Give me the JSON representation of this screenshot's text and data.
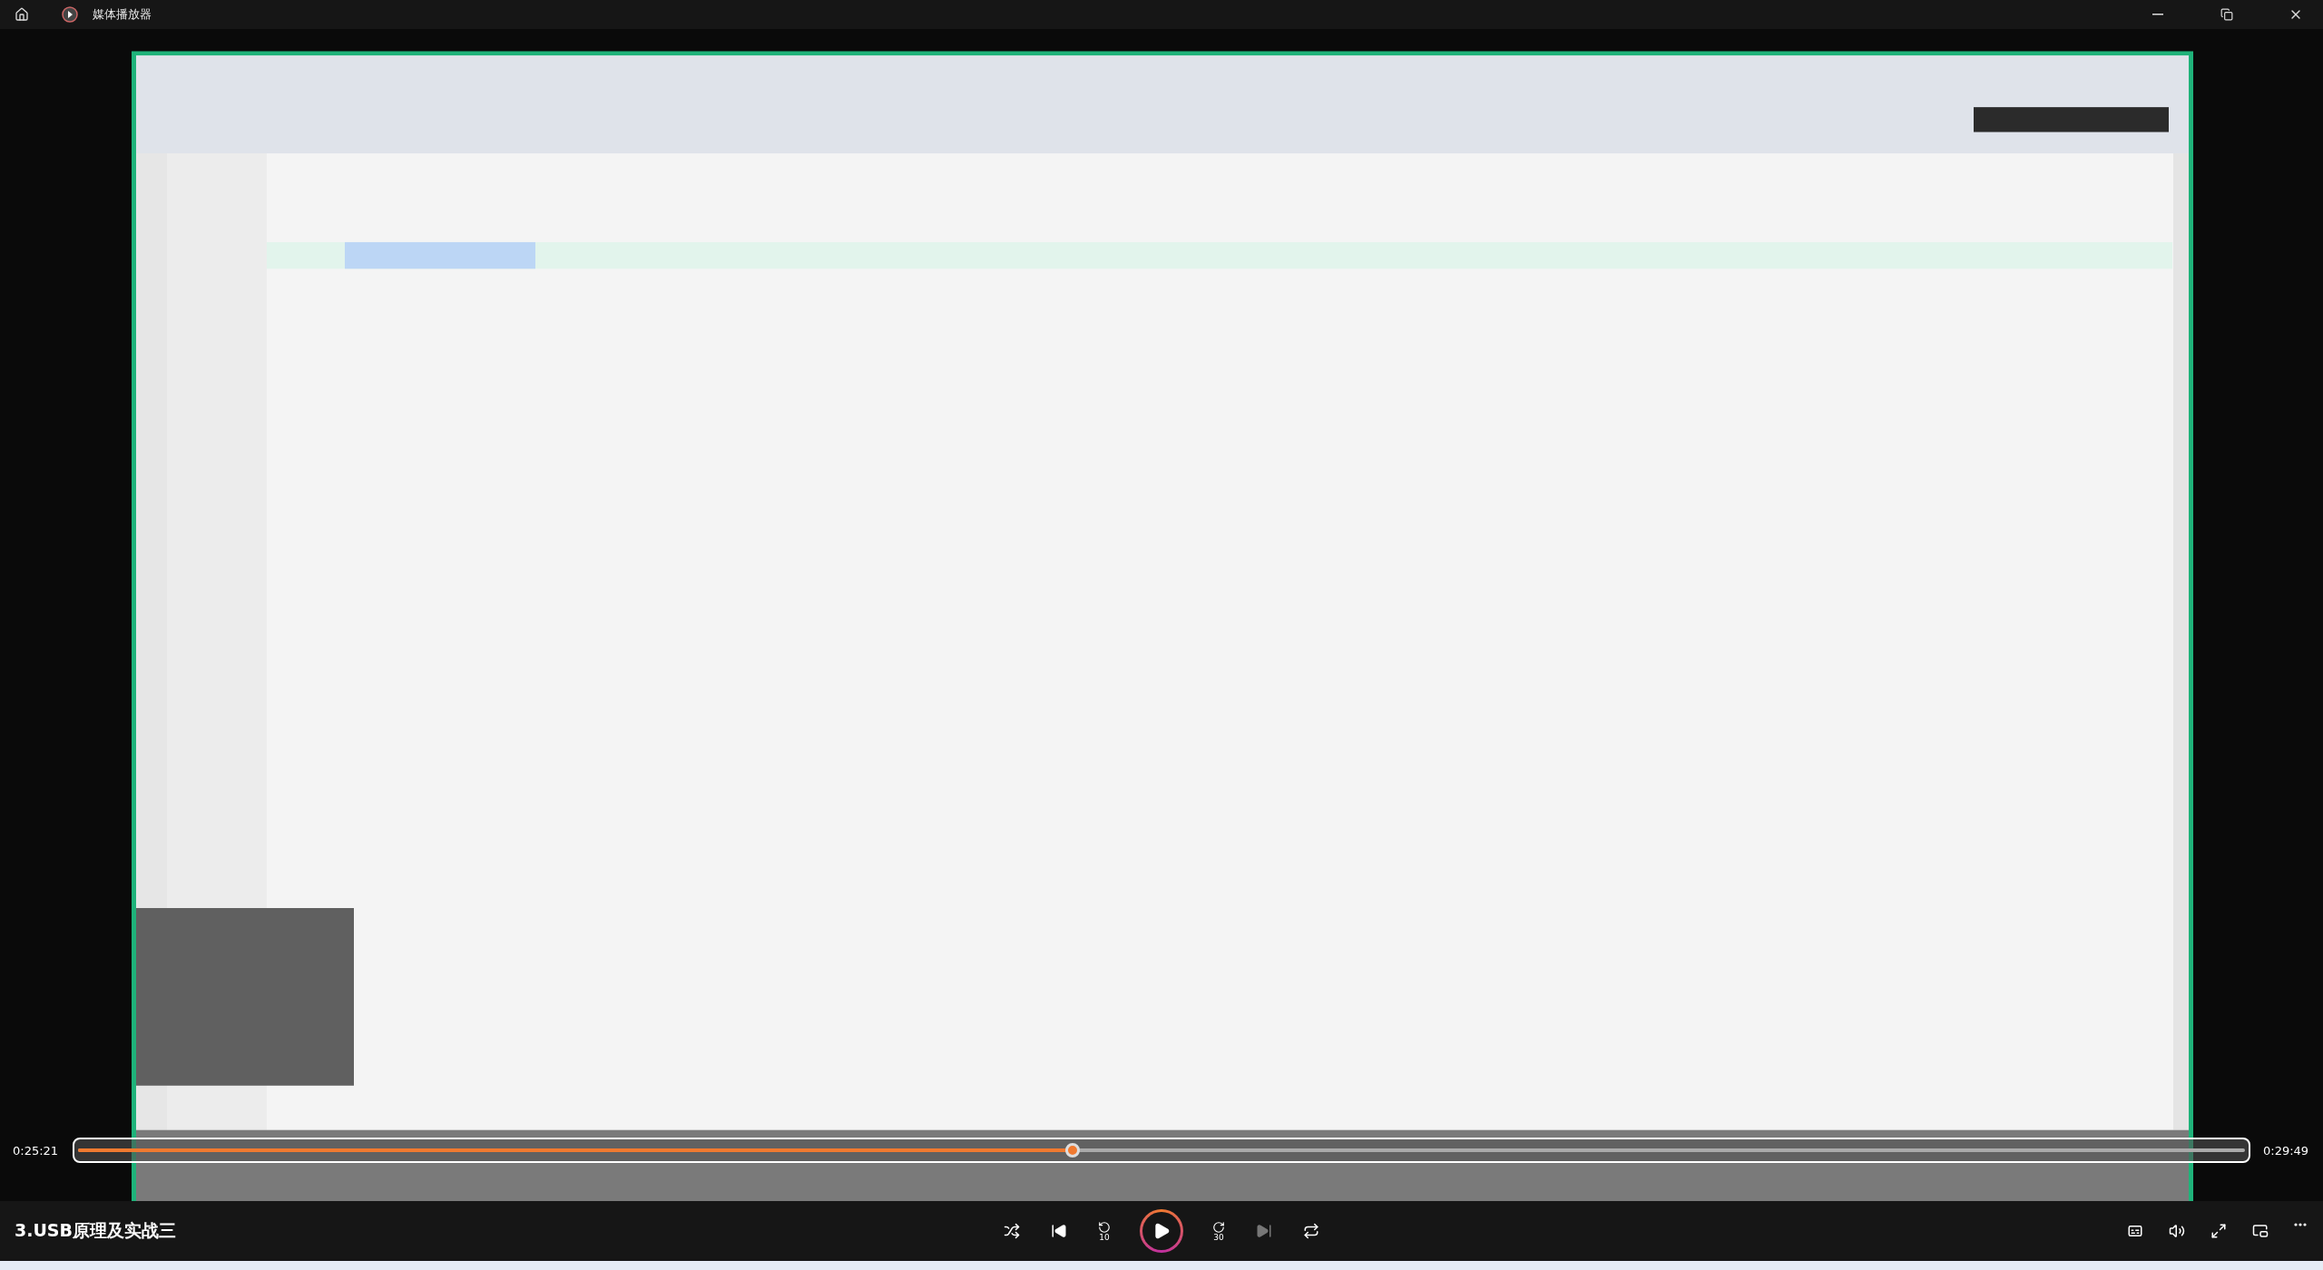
{
  "window": {
    "title": "媒体播放器"
  },
  "playback": {
    "elapsed": "0:25:21",
    "total": "0:29:49",
    "level": 0.459
  },
  "media_title": "3.USB原理及实战三",
  "controls": {
    "skip_back_seconds": "10",
    "skip_forward_seconds": "30",
    "playing": false
  }
}
